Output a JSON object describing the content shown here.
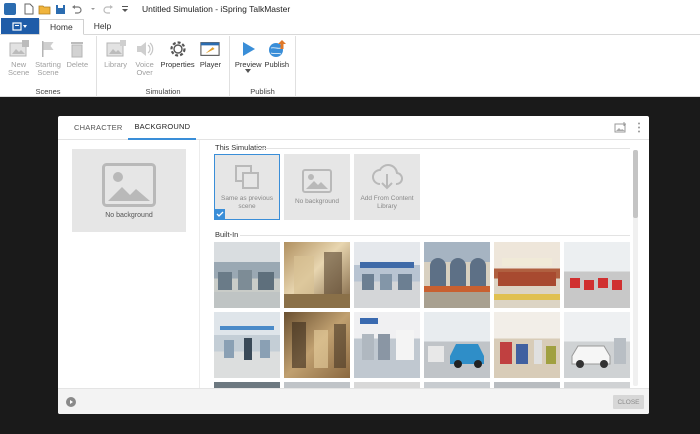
{
  "window": {
    "title": "Untitled Simulation - iSpring TalkMaster"
  },
  "menu": {
    "tabs": [
      {
        "label": "Home"
      },
      {
        "label": "Help"
      }
    ]
  },
  "ribbon": {
    "groups": {
      "scenes": {
        "label": "Scenes",
        "new_scene": "New Scene",
        "starting_scene": "Starting Scene",
        "delete": "Delete"
      },
      "simulation": {
        "label": "Simulation",
        "library": "Library",
        "voice_over": "Voice Over",
        "properties": "Properties",
        "player": "Player"
      },
      "publish": {
        "label": "Publish",
        "preview": "Preview",
        "publish": "Publish"
      }
    }
  },
  "dialog": {
    "tabs": [
      {
        "label": "CHARACTER"
      },
      {
        "label": "BACKGROUND"
      }
    ],
    "active_tab": "BACKGROUND",
    "preview_label": "No background",
    "this_simulation": {
      "title": "This Simulation",
      "items": [
        {
          "label": "Same as previous scene",
          "selected": true
        },
        {
          "label": "No background",
          "selected": false
        },
        {
          "label": "Add From Content Library",
          "selected": false
        }
      ]
    },
    "built_in": {
      "title": "Built-In"
    },
    "close_label": "CLOSE"
  },
  "colors": {
    "accent": "#3a8ed8",
    "file_button": "#1f5ca8",
    "stage": "#1a1a1a"
  }
}
